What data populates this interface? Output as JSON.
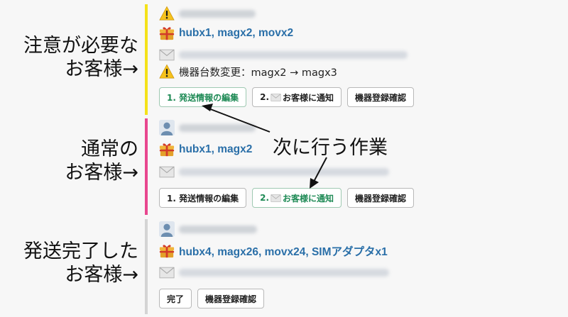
{
  "side_labels": {
    "attention": [
      "注意が必要な",
      "お客様→"
    ],
    "normal": [
      "通常の",
      "お客様→"
    ],
    "shipped": [
      "発送完了した",
      "お客様→"
    ]
  },
  "annotation": "次に行う作業",
  "cards": [
    {
      "status": "attention",
      "bar_color": "#f4e21a",
      "avatar_icon": "warning-icon",
      "products": "hubx1, magx2, movx2",
      "warning": "機器台数変更：magx2 → magx3",
      "buttons": {
        "edit": "1. 発送情報の編集",
        "notify_prefix": "2.",
        "notify": "お客様に通知",
        "check": "機器登録確認"
      }
    },
    {
      "status": "normal",
      "bar_color": "#e8478f",
      "avatar_icon": "person-icon",
      "products": "hubx1, magx2",
      "buttons": {
        "edit": "1. 発送情報の編集",
        "notify_prefix": "2.",
        "notify": "お客様に通知",
        "check": "機器登録確認"
      }
    },
    {
      "status": "shipped",
      "bar_color": "#d4d4d4",
      "avatar_icon": "person-icon",
      "products": "hubx4, magx26, movx24, SIMアダプタx1",
      "buttons": {
        "done": "完了",
        "check": "機器登録確認"
      }
    }
  ],
  "colors": {
    "product_text": "#2a6fa8",
    "active_button_text": "#1e8a55",
    "gift_icon": "#e8a82a"
  }
}
